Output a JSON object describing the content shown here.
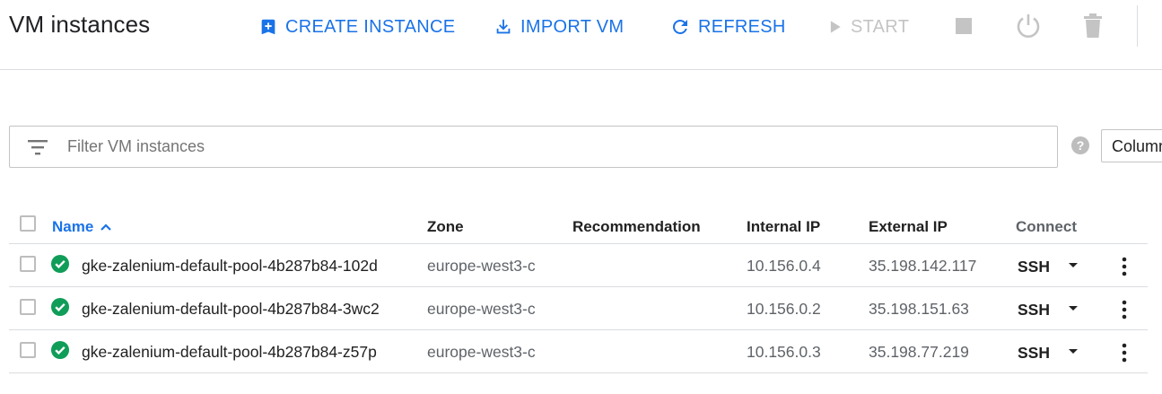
{
  "header": {
    "title": "VM instances",
    "create_label": "CREATE INSTANCE",
    "import_label": "IMPORT VM",
    "refresh_label": "REFRESH",
    "start_label": "START"
  },
  "filter": {
    "placeholder": "Filter VM instances",
    "columns_label": "Columns"
  },
  "table": {
    "columns": {
      "name": "Name",
      "zone": "Zone",
      "recommendation": "Recommendation",
      "internal_ip": "Internal IP",
      "external_ip": "External IP",
      "connect": "Connect"
    },
    "rows": [
      {
        "name": "gke-zalenium-default-pool-4b287b84-102d",
        "zone": "europe-west3-c",
        "recommendation": "",
        "internal_ip": "10.156.0.4",
        "external_ip": "35.198.142.117",
        "connect": "SSH"
      },
      {
        "name": "gke-zalenium-default-pool-4b287b84-3wc2",
        "zone": "europe-west3-c",
        "recommendation": "",
        "internal_ip": "10.156.0.2",
        "external_ip": "35.198.151.63",
        "connect": "SSH"
      },
      {
        "name": "gke-zalenium-default-pool-4b287b84-z57p",
        "zone": "europe-west3-c",
        "recommendation": "",
        "internal_ip": "10.156.0.3",
        "external_ip": "35.198.77.219",
        "connect": "SSH"
      }
    ]
  },
  "colors": {
    "accent": "#1a73e8",
    "status_ok": "#0f9d58",
    "disabled": "#c4c4c4"
  }
}
